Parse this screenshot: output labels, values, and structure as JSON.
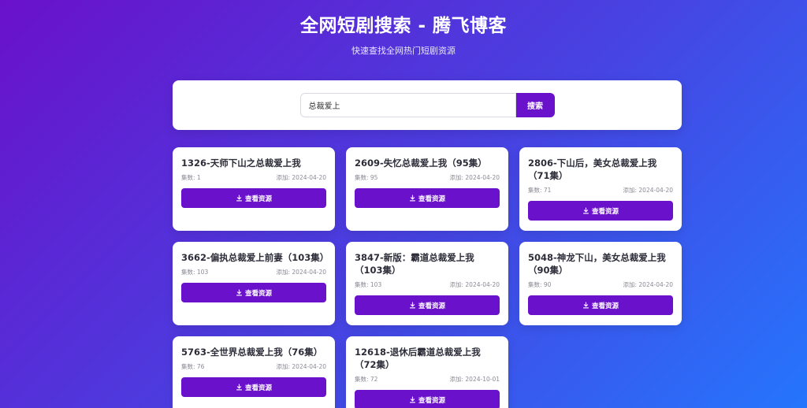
{
  "header": {
    "title": "全网短剧搜索 - 腾飞博客",
    "subtitle": "快速查找全网热门短剧资源"
  },
  "search": {
    "value": "总裁爱上",
    "button_label": "搜索"
  },
  "results": [
    {
      "title": "1326-天师下山之总裁爱上我",
      "episodes": "集数: 1",
      "added": "添加: 2024-04-20",
      "button_label": "查看资源"
    },
    {
      "title": "2609-失忆总裁爱上我（95集）",
      "episodes": "集数: 95",
      "added": "添加: 2024-04-20",
      "button_label": "查看资源"
    },
    {
      "title": "2806-下山后，美女总裁爱上我（71集）",
      "episodes": "集数: 71",
      "added": "添加: 2024-04-20",
      "button_label": "查看资源"
    },
    {
      "title": "3662-偏执总裁爱上前妻（103集）",
      "episodes": "集数: 103",
      "added": "添加: 2024-04-20",
      "button_label": "查看资源"
    },
    {
      "title": "3847-新版：霸道总裁爱上我（103集）",
      "episodes": "集数: 103",
      "added": "添加: 2024-04-20",
      "button_label": "查看资源"
    },
    {
      "title": "5048-神龙下山，美女总裁爱上我（90集）",
      "episodes": "集数: 90",
      "added": "添加: 2024-04-20",
      "button_label": "查看资源"
    },
    {
      "title": "5763-全世界总裁爱上我（76集）",
      "episodes": "集数: 76",
      "added": "添加: 2024-04-20",
      "button_label": "查看资源"
    },
    {
      "title": "12618-退休后霸道总裁爱上我（72集）",
      "episodes": "集数: 72",
      "added": "添加: 2024-10-01",
      "button_label": "查看资源"
    }
  ],
  "colors": {
    "accent": "#6a11cb",
    "gradient_start": "#6a11cb",
    "gradient_end": "#2575fc"
  },
  "icons": {
    "view_button_icon": "download-icon"
  }
}
